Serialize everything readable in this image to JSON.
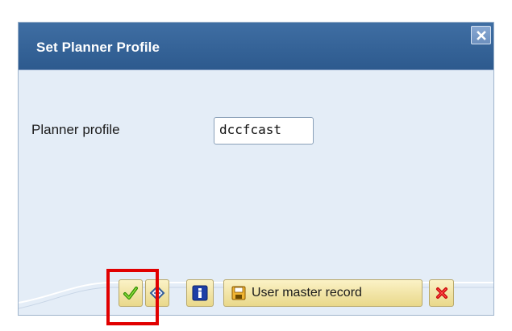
{
  "dialog": {
    "title": "Set Planner Profile",
    "close_icon": "close-icon"
  },
  "form": {
    "planner_profile_label": "Planner profile",
    "planner_profile_value": "dccfcast"
  },
  "footer": {
    "ok_icon": "checkmark-icon",
    "other_icon": "diamond-icon",
    "info_icon": "info-icon",
    "user_master_record_label": "User master record",
    "user_master_record_icon": "save-icon",
    "cancel_icon": "cancel-icon"
  },
  "colors": {
    "titlebar": "#2d5a8e",
    "dialog_background": "#e4edf7",
    "button_background": "#f1e3a8",
    "highlight": "#e10000"
  }
}
